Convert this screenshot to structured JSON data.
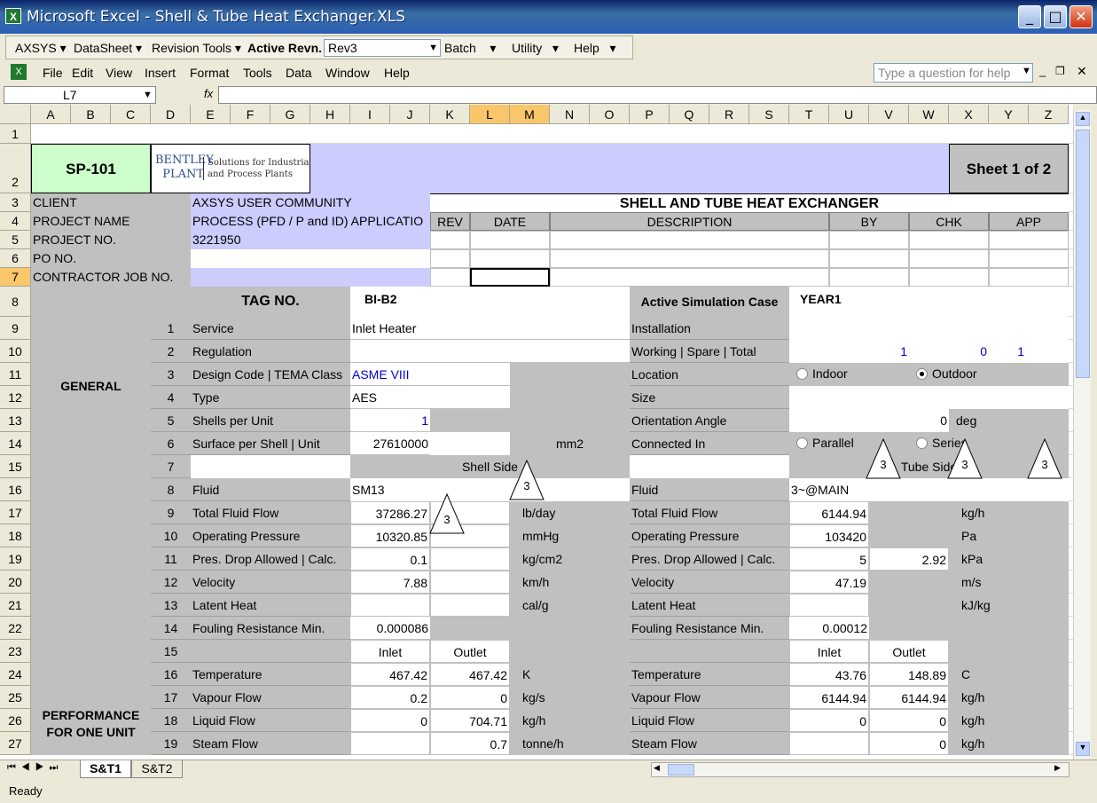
{
  "window": {
    "title": "Microsoft Excel - Shell & Tube Heat Exchanger.XLS"
  },
  "axsys_toolbar": {
    "items": [
      "AXSYS",
      "DataSheet",
      "Revision Tools"
    ],
    "active_revn_label": "Active Revn.",
    "active_revn_value": "Rev3",
    "batch": "Batch",
    "utility": "Utility",
    "help": "Help"
  },
  "menu": {
    "items": [
      "File",
      "Edit",
      "View",
      "Insert",
      "Format",
      "Tools",
      "Data",
      "Window",
      "Help"
    ],
    "help_placeholder": "Type a question for help"
  },
  "formula_bar": {
    "name_box": "L7",
    "fx": "fx",
    "value": ""
  },
  "columns": [
    "A",
    "B",
    "C",
    "D",
    "E",
    "F",
    "G",
    "H",
    "I",
    "J",
    "K",
    "L",
    "M",
    "N",
    "O",
    "P",
    "Q",
    "R",
    "S",
    "T",
    "U",
    "V",
    "W",
    "X",
    "Y",
    "Z"
  ],
  "rows": [
    "1",
    "2",
    "3",
    "4",
    "5",
    "6",
    "7",
    "8",
    "9",
    "10",
    "11",
    "12",
    "13",
    "14",
    "15",
    "16",
    "17",
    "18",
    "19",
    "20",
    "21",
    "22",
    "23",
    "24",
    "25",
    "26",
    "27"
  ],
  "sheet": {
    "doc_no": "SP-101",
    "logo_top": "BENTLEY",
    "logo_bottom": "PLANT",
    "logo_tag1": "Solutions for Industrial",
    "logo_tag2": "and Process Plants",
    "sheet_of": "Sheet 1 of 2",
    "title": "SHELL AND TUBE HEAT EXCHANGER",
    "client_label": "CLIENT",
    "client": "AXSYS USER COMMUNITY",
    "project_label": "PROJECT NAME",
    "project": "PROCESS (PFD / P and ID) APPLICATIO",
    "projno_label": "PROJECT NO.",
    "projno": "3221950",
    "po_label": "PO NO.",
    "contractor_label": "CONTRACTOR JOB NO.",
    "rev_headers": [
      "REV",
      "DATE",
      "DESCRIPTION",
      "BY",
      "CHK",
      "APP"
    ],
    "tag_label": "TAG NO.",
    "tag": "BI-B2",
    "sim_label": "Active Simulation Case",
    "sim": "YEAR1",
    "general": "GENERAL",
    "performance": "PERFORMANCE",
    "for_one_unit": "FOR ONE UNIT",
    "line_nums": [
      "1",
      "2",
      "3",
      "4",
      "5",
      "6",
      "7",
      "8",
      "9",
      "10",
      "11",
      "12",
      "13",
      "14",
      "15",
      "16",
      "17",
      "18",
      "19"
    ],
    "service_label": "Service",
    "service": "Inlet Heater",
    "regulation_label": "Regulation",
    "design_label": "Design Code | TEMA Class",
    "design": "ASME VIII",
    "type_label": "Type",
    "type": "AES",
    "shells_label": "Shells per Unit",
    "shells": "1",
    "surface_label": "Surface per     Shell | Unit",
    "surface": "27610000",
    "surface_unit": "mm2",
    "installation_label": "Installation",
    "working_label": "Working | Spare | Total",
    "working": "1",
    "spare": "0",
    "total": "1",
    "location_label": "Location",
    "indoor": "Indoor",
    "outdoor": "Outdoor",
    "size_label": "Size",
    "orient_label": "Orientation Angle",
    "orient": "0",
    "orient_unit": "deg",
    "connected_label": "Connected In",
    "parallel": "Parallel",
    "series": "Series",
    "rev_marker": "3",
    "shell_side": "Shell Side",
    "tube_side": "Tube Side",
    "fluid_label": "Fluid",
    "shell_fluid": "SM13",
    "tube_fluid": "3~@MAIN",
    "tff_label": "Total Fluid Flow",
    "shell_tff": "37286.27",
    "shell_tff_u": "lb/day",
    "tube_tff": "6144.94",
    "tube_tff_u": "kg/h",
    "op_label": "Operating Pressure",
    "shell_op": "10320.85",
    "shell_op_u": "mmHg",
    "tube_op": "103420",
    "tube_op_u": "Pa",
    "pd_label": "Pres. Drop Allowed | Calc.",
    "shell_pd": "0.1",
    "shell_pd_u": "kg/cm2",
    "tube_pd": "5",
    "tube_pd_calc": "2.92",
    "tube_pd_u": "kPa",
    "vel_label": "Velocity",
    "shell_vel": "7.88",
    "shell_vel_u": "km/h",
    "tube_vel": "47.19",
    "tube_vel_u": "m/s",
    "lh_label": "Latent Heat",
    "shell_lh_u": "cal/g",
    "tube_lh_u": "kJ/kg",
    "foul_label": "Fouling Resistance Min.",
    "shell_foul": "0.000086",
    "tube_foul": "0.00012",
    "inlet": "Inlet",
    "outlet": "Outlet",
    "temp_label": "Temperature",
    "shell_tin": "467.42",
    "shell_tout": "467.42",
    "shell_t_u": "K",
    "tube_tin": "43.76",
    "tube_tout": "148.89",
    "tube_t_u": "C",
    "vap_label": "Vapour Flow",
    "shell_vin": "0.2",
    "shell_vout": "0",
    "shell_v_u": "kg/s",
    "tube_vin": "6144.94",
    "tube_vout": "6144.94",
    "tube_v_u": "kg/h",
    "liq_label": "Liquid Flow",
    "shell_lin": "0",
    "shell_lout": "704.71",
    "shell_l_u": "kg/h",
    "tube_lin": "0",
    "tube_lout": "0",
    "tube_l_u": "kg/h",
    "steam_label": "Steam Flow",
    "shell_steam": "0.7",
    "shell_steam_u": "tonne/h",
    "tube_steam": "0",
    "tube_steam_u": "kg/h"
  },
  "tabs": [
    "S&T1",
    "S&T2"
  ],
  "status": "Ready"
}
